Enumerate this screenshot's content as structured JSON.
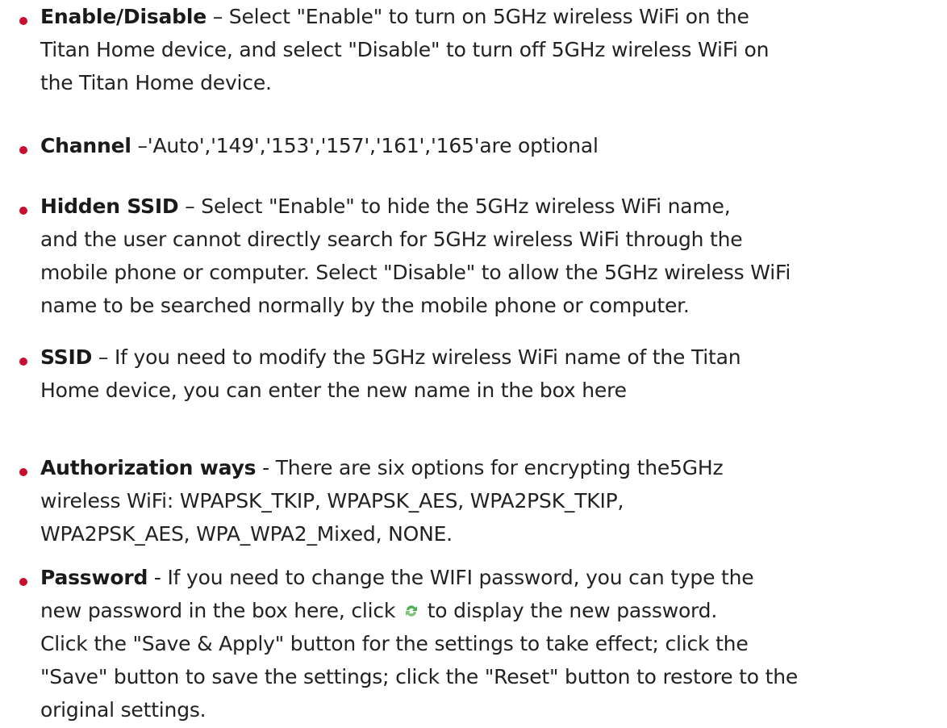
{
  "items": [
    {
      "term": "Enable/Disable",
      "lines": [
        " – Select \"Enable\" to turn on 5GHz wireless WiFi on the",
        "Titan Home device, and select \"Disable\" to turn off 5GHz wireless WiFi on",
        "the Titan Home device."
      ]
    },
    {
      "term": "Channel",
      "lines": [
        " –'Auto','149','153','157','161','165'are optional"
      ]
    },
    {
      "term": "Hidden SSID",
      "lines": [
        " – Select \"Enable\" to hide the 5GHz wireless WiFi name,",
        "and the user cannot directly search for 5GHz wireless WiFi through the",
        "mobile phone or computer. Select \"Disable\" to allow the 5GHz wireless WiFi",
        "name to be searched normally by the mobile phone or computer."
      ]
    },
    {
      "term": "SSID",
      "lines": [
        " – If you need to modify the 5GHz wireless WiFi name of the Titan",
        "Home device, you can enter the new name in the box here"
      ]
    },
    {
      "term": "Authorization ways",
      "lines": [
        " - There are six options for encrypting the5GHz",
        "wireless WiFi: WPAPSK_TKIP, WPAPSK_AES, WPA2PSK_TKIP,",
        "WPA2PSK_AES, WPA_WPA2_Mixed, NONE."
      ]
    },
    {
      "term": "Password",
      "lines": [
        " - If you need to change the WIFI password, you can type the",
        "new password in the box here, click ",
        "Click the \"Save & Apply\" button for the settings to take effect; click the",
        "\"Save\" button to save the settings; click the \"Reset\" button to restore to the",
        "original settings."
      ],
      "line2_after_icon": " to display the new password.",
      "icon": "refresh-icon"
    }
  ],
  "colors": {
    "bullet": "#c8102e",
    "text": "#222222",
    "icon_green": "#4caf50"
  }
}
